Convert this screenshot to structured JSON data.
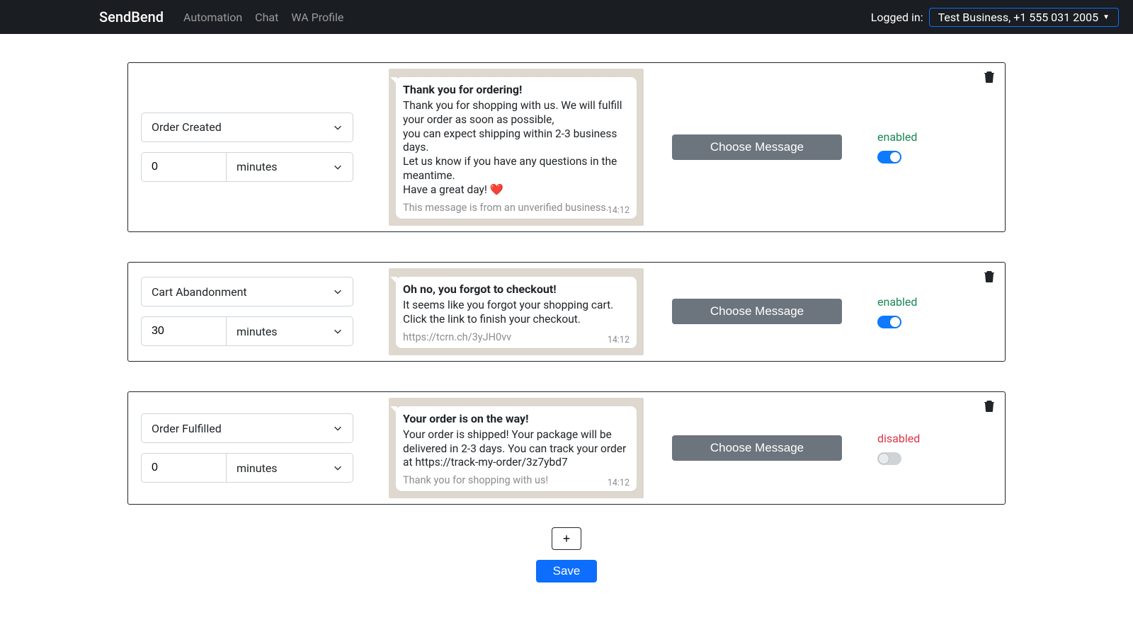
{
  "nav": {
    "brand": "SendBend",
    "links": [
      "Automation",
      "Chat",
      "WA Profile"
    ],
    "logged_in_label": "Logged in:",
    "account_label": "Test Business, +1 555 031 2005"
  },
  "rules": [
    {
      "trigger": "Order Created",
      "delay_value": "0",
      "delay_unit": "minutes",
      "message": {
        "title": "Thank you for ordering!",
        "body": "Thank you for shopping with us. We will fulfill your order as soon as possible,\nyou can expect shipping within 2-3 business days.\nLet us know if you have any questions in the meantime.\nHave a great day! ❤️",
        "footer": "This message is from an unverified business.",
        "time": "14:12"
      },
      "choose_label": "Choose Message",
      "enabled": true,
      "status_label": "enabled"
    },
    {
      "trigger": "Cart Abandonment",
      "delay_value": "30",
      "delay_unit": "minutes",
      "message": {
        "title": "Oh no, you forgot to checkout!",
        "body": "It seems like you forgot your shopping cart. Click the link to finish your checkout.",
        "footer": "https://tcrn.ch/3yJH0vv",
        "time": "14:12"
      },
      "choose_label": "Choose Message",
      "enabled": true,
      "status_label": "enabled"
    },
    {
      "trigger": "Order Fulfilled",
      "delay_value": "0",
      "delay_unit": "minutes",
      "message": {
        "title": "Your order is on the way!",
        "body": "Your order is shipped! Your package will be delivered in 2-3 days. You can track your order at https://track-my-order/3z7ybd7",
        "footer": "Thank you for shopping with us!",
        "time": "14:12"
      },
      "choose_label": "Choose Message",
      "enabled": false,
      "status_label": "disabled"
    }
  ],
  "actions": {
    "add_label": "+",
    "save_label": "Save"
  }
}
